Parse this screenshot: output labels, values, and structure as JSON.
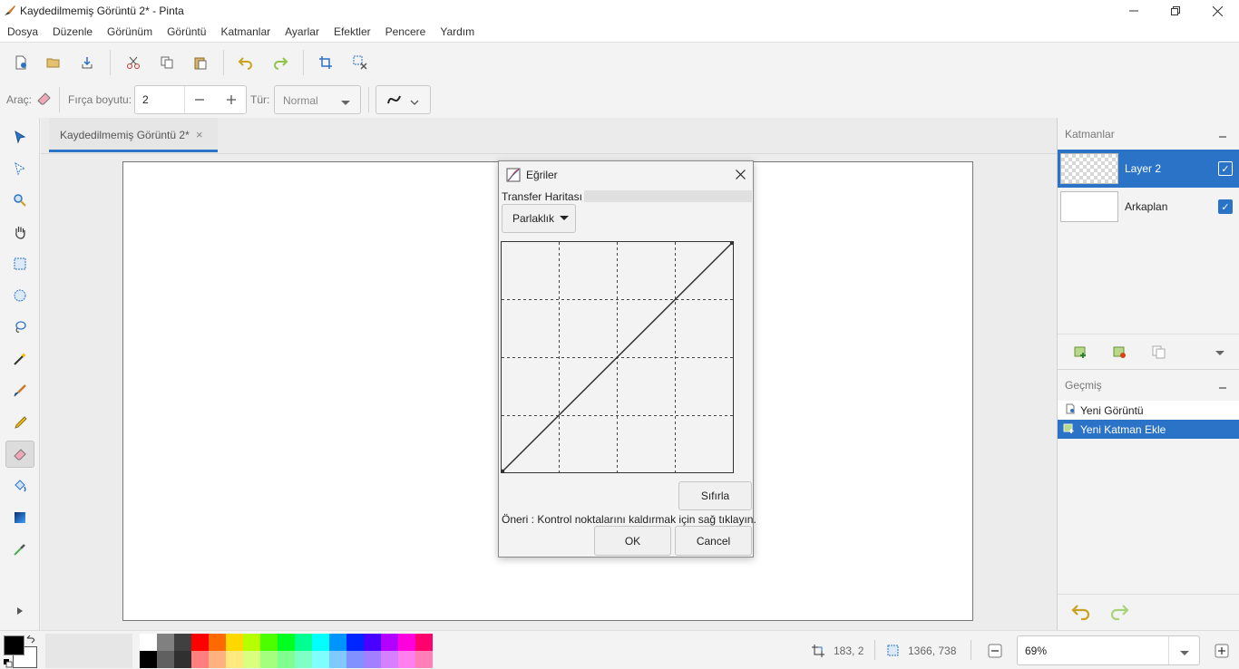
{
  "window": {
    "title": "Kaydedilmemiş Görüntü 2* - Pinta"
  },
  "menu": [
    "Dosya",
    "Düzenle",
    "Görünüm",
    "Görüntü",
    "Katmanlar",
    "Ayarlar",
    "Efektler",
    "Pencere",
    "Yardım"
  ],
  "options": {
    "tool_label": "Araç:",
    "brush_size_label": "Fırça boyutu:",
    "brush_size_value": "2",
    "type_label": "Tür:",
    "type_value": "Normal"
  },
  "document_tab": {
    "label": "Kaydedilmemiş Görüntü 2*",
    "close": "×"
  },
  "layers_panel": {
    "title": "Katmanlar",
    "layers": [
      {
        "name": "Layer 2",
        "selected": true,
        "visible": true
      },
      {
        "name": "Arkaplan",
        "selected": false,
        "visible": true
      }
    ]
  },
  "history_panel": {
    "title": "Geçmiş",
    "items": [
      {
        "label": "Yeni Görüntü",
        "selected": false
      },
      {
        "label": "Yeni Katman Ekle",
        "selected": true
      }
    ]
  },
  "status": {
    "cursor_position": "183, 2",
    "selection_size": "1366, 738",
    "zoom": "69%"
  },
  "palette": {
    "top": [
      "#ffffff",
      "#808080",
      "#404040",
      "#ff0000",
      "#ff6a00",
      "#ffd800",
      "#b6ff00",
      "#4cff00",
      "#00ff21",
      "#00ff90",
      "#00ffff",
      "#0094ff",
      "#0026ff",
      "#4800ff",
      "#b200ff",
      "#ff00dc",
      "#ff006e"
    ],
    "bottom": [
      "#000000",
      "#606060",
      "#303030",
      "#ff7f7f",
      "#ffb27f",
      "#ffe97f",
      "#daff7f",
      "#a5ff7f",
      "#7fff8e",
      "#7fffc5",
      "#7fffff",
      "#7fc9ff",
      "#7f92ff",
      "#a17fff",
      "#d67fff",
      "#ff7fed",
      "#ff7fb6"
    ]
  },
  "dialog": {
    "title": "Eğriler",
    "transfer_map_label": "Transfer Haritası",
    "mode_value": "Parlaklık",
    "reset_button": "Sıfırla",
    "hint": "Öneri : Kontrol noktalarını kaldırmak için sağ tıklayın.",
    "ok_button": "OK",
    "cancel_button": "Cancel"
  },
  "colors": {
    "accent": "#2b73c6",
    "primary_color": "#000000",
    "secondary_color": "#ffffff"
  }
}
